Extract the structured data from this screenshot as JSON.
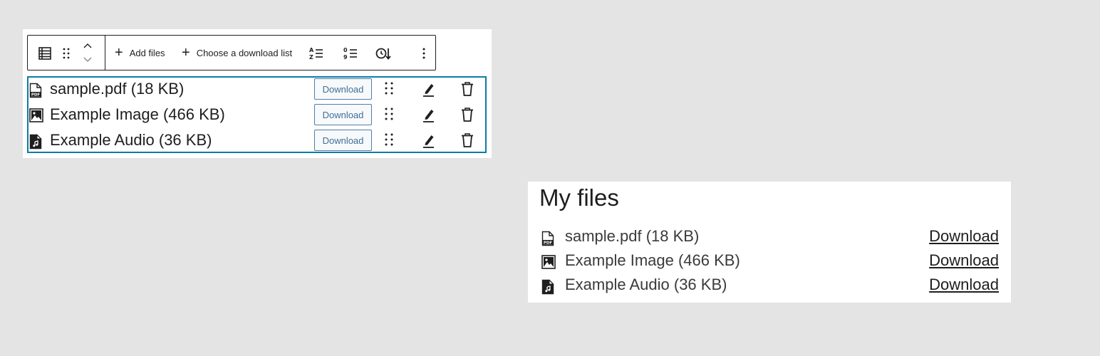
{
  "editor": {
    "toolbar": {
      "add_files_label": "Add files",
      "choose_list_label": "Choose a download list",
      "icons": [
        "block-list-icon",
        "drag-handle-icon",
        "chevron-up-icon",
        "chevron-down-icon",
        "sort-alphabetical-icon",
        "sort-numeric-icon",
        "sort-date-icon",
        "more-options-icon"
      ]
    },
    "files": [
      {
        "name": "sample.pdf (18 KB)",
        "icon": "pdf-file-icon",
        "button_label": "Download"
      },
      {
        "name": "Example Image (466 KB)",
        "icon": "image-file-icon",
        "button_label": "Download"
      },
      {
        "name": "Example Audio (36 KB)",
        "icon": "audio-file-icon",
        "button_label": "Download"
      }
    ],
    "accent_color": "#0d7ba8"
  },
  "preview": {
    "title": "My files",
    "files": [
      {
        "name": "sample.pdf (18 KB)",
        "icon": "pdf-file-icon",
        "link_label": "Download"
      },
      {
        "name": "Example Image (466 KB)",
        "icon": "image-file-icon",
        "link_label": "Download"
      },
      {
        "name": "Example Audio (36 KB)",
        "icon": "audio-file-icon",
        "link_label": "Download"
      }
    ]
  },
  "file_icon_text": "PDF"
}
